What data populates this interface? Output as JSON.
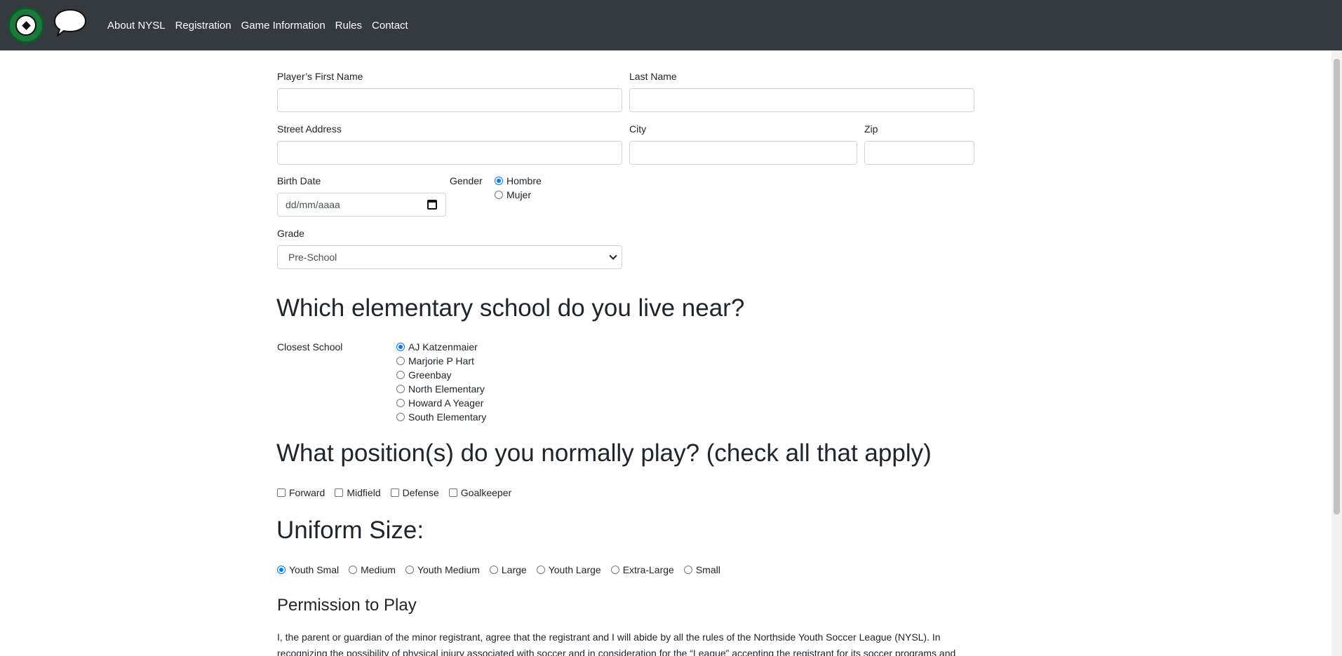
{
  "nav": {
    "items": [
      "About NYSL",
      "Registration",
      "Game Information",
      "Rules",
      "Contact"
    ]
  },
  "form": {
    "first_name_label": "Player’s First Name",
    "last_name_label": "Last Name",
    "street_label": "Street Address",
    "city_label": "City",
    "zip_label": "Zip",
    "birth_label": "Birth Date",
    "birth_placeholder": "dd/mm/aaaa",
    "gender_label": "Gender",
    "gender_options": [
      "Hombre",
      "Mujer"
    ],
    "gender_selected": "Hombre",
    "grade_label": "Grade",
    "grade_value": "Pre-School"
  },
  "school": {
    "heading": "Which elementary school do you live near?",
    "label": "Closest School",
    "options": [
      "AJ Katzenmaier",
      "Marjorie P Hart",
      "Greenbay",
      "North Elementary",
      "Howard A Yeager",
      "South Elementary"
    ],
    "selected": "AJ Katzenmaier"
  },
  "positions": {
    "heading": "What position(s) do you normally play? (check all that apply)",
    "options": [
      "Forward",
      "Midfield",
      "Defense",
      "Goalkeeper"
    ]
  },
  "uniform": {
    "heading": "Uniform Size:",
    "options": [
      "Youth Smal",
      "Medium",
      "Youth Medium",
      "Large",
      "Youth Large",
      "Extra-Large",
      "Small"
    ],
    "selected": "Youth Smal"
  },
  "permission": {
    "heading": "Permission to Play",
    "text": "I, the parent or guardian of the minor registrant, agree that the registrant and I will abide by all the rules of the Northside Youth Soccer League (NYSL). In recognizing the possibility of physical injury associated with soccer and in consideration for the “League” accepting the registrant for its soccer programs and"
  }
}
